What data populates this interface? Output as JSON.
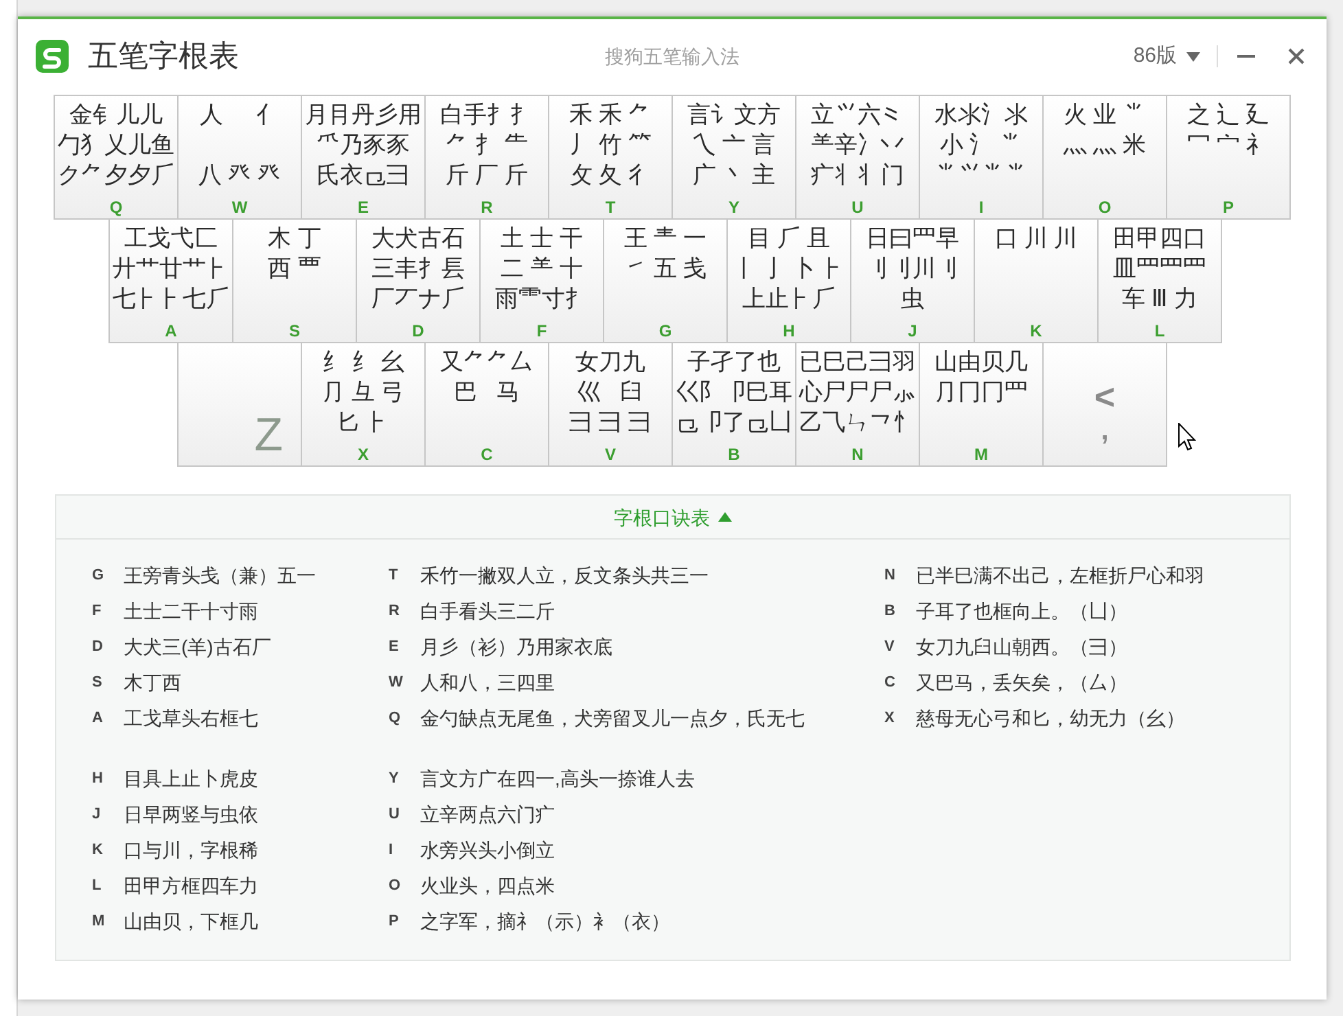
{
  "window": {
    "title": "五笔字根表",
    "subtitle": "搜狗五笔输入法",
    "version": "86版"
  },
  "keyboard": {
    "rows": [
      [
        {
          "kind": "radicals",
          "letter": "Q",
          "lines": [
            "金钅儿儿",
            "勹犭乂儿鱼",
            "ク⺈夕夕⺁"
          ]
        },
        {
          "kind": "radicals-spread",
          "letter": "W",
          "lines": [
            "人     亻",
            "八 癶 癶"
          ]
        },
        {
          "kind": "radicals",
          "letter": "E",
          "lines": [
            "月⺝丹彡用",
            "⺥乃豕豕",
            "氏衣⺋⺕"
          ]
        },
        {
          "kind": "radicals",
          "letter": "R",
          "lines": [
            "白手⺘扌",
            "⺈ ⺘ ⺧",
            "斤 厂 斤"
          ]
        },
        {
          "kind": "radicals",
          "letter": "T",
          "lines": [
            "禾 ⽲ ⺈",
            "丿 竹 ⺮",
            "攵 夂 彳"
          ]
        },
        {
          "kind": "radicals",
          "letter": "Y",
          "lines": [
            "言讠文方",
            "乀 亠 言",
            "广 丶 主"
          ]
        },
        {
          "kind": "radicals",
          "letter": "U",
          "lines": [
            "立⺍六⺀",
            "⺷辛冫丷",
            "疒丬丬门"
          ]
        },
        {
          "kind": "radicals",
          "letter": "I",
          "lines": [
            "水氺⺡⺢",
            "小 氵 ⺌",
            "⺌⺍⺌⺌"
          ]
        },
        {
          "kind": "radicals",
          "letter": "O",
          "lines": [
            "火 业 ⺌",
            "灬 ⺣ 米"
          ]
        },
        {
          "kind": "radicals",
          "letter": "P",
          "lines": [
            "之 辶 廴",
            "冖 宀 礻"
          ]
        }
      ],
      [
        {
          "kind": "radicals",
          "letter": "A",
          "lines": [
            "工戈弋匚",
            "廾艹廿⺾⺊",
            "七⺊⺊七⺁"
          ]
        },
        {
          "kind": "radicals",
          "letter": "S",
          "lines": [
            "木 丁",
            "西 覀"
          ]
        },
        {
          "kind": "radicals",
          "letter": "D",
          "lines": [
            "大犬古石",
            "三丰⺘镸",
            "厂丆ナ⺁"
          ]
        },
        {
          "kind": "radicals",
          "letter": "F",
          "lines": [
            "土 士 干",
            "二 ⺷ 十",
            "雨⻗寸⺘"
          ]
        },
        {
          "kind": "radicals",
          "letter": "G",
          "lines": [
            "王 龶 一",
            "㇀ 五 戋"
          ]
        },
        {
          "kind": "radicals",
          "letter": "H",
          "lines": [
            "目 ⺁ 且",
            "丨 亅 卜 ⺊",
            "上止⺊⺁"
          ]
        },
        {
          "kind": "radicals",
          "letter": "J",
          "lines": [
            "日曰⺫早",
            "刂刂川刂",
            "虫"
          ]
        },
        {
          "kind": "radicals",
          "letter": "K",
          "lines": [
            "口 川 川"
          ]
        },
        {
          "kind": "radicals",
          "letter": "L",
          "lines": [
            "田甲四口",
            "皿罒⺫⺲",
            "车 Ⅲ 力"
          ]
        }
      ],
      [
        {
          "kind": "letter",
          "letter": "Z"
        },
        {
          "kind": "radicals",
          "letter": "X",
          "lines": [
            "纟 纟 幺",
            "⺆ 彑 弓",
            "匕 ⺊"
          ]
        },
        {
          "kind": "radicals",
          "letter": "C",
          "lines": [
            "又⺈⺈厶",
            "巴   马"
          ]
        },
        {
          "kind": "radicals",
          "letter": "V",
          "lines": [
            "女刀九",
            "巛   臼",
            "彐 ⺕ ⺕"
          ]
        },
        {
          "kind": "radicals",
          "letter": "B",
          "lines": [
            "子孑了也",
            "巜阝卩巳耳",
            "⺋卩了⺋凵"
          ]
        },
        {
          "kind": "radicals",
          "letter": "N",
          "lines": [
            "已巳己⺕羽",
            "心尸尸尸⺗",
            "乙⺄ㄣ⺂⺖"
          ]
        },
        {
          "kind": "radicals",
          "letter": "M",
          "lines": [
            "山由贝几",
            "⺆冂冂⺫"
          ]
        },
        {
          "kind": "symbols",
          "lines": [
            "<",
            ","
          ]
        }
      ]
    ]
  },
  "mnemonics": {
    "title": "字根口诀表",
    "expanded": true,
    "columns": [
      [
        [
          {
            "key": "G",
            "text": "王旁青头戋（兼）五一"
          },
          {
            "key": "F",
            "text": "土士二干十寸雨"
          },
          {
            "key": "D",
            "text": "大犬三(羊)古石厂"
          },
          {
            "key": "S",
            "text": "木丁西"
          },
          {
            "key": "A",
            "text": "工戈草头右框七"
          }
        ],
        [
          {
            "key": "H",
            "text": "目具上止卜虎皮"
          },
          {
            "key": "J",
            "text": "日早两竖与虫依"
          },
          {
            "key": "K",
            "text": "口与川，字根稀"
          },
          {
            "key": "L",
            "text": "田甲方框四车力"
          },
          {
            "key": "M",
            "text": "山由贝，下框几"
          }
        ]
      ],
      [
        [
          {
            "key": "T",
            "text": "禾竹一撇双人立，反文条头共三一"
          },
          {
            "key": "R",
            "text": "白手看头三二斤"
          },
          {
            "key": "E",
            "text": "月彡（衫）乃用家衣底"
          },
          {
            "key": "W",
            "text": "人和八，三四里"
          },
          {
            "key": "Q",
            "text": "金勺缺点无尾鱼，犬旁留叉儿一点夕，氏无七"
          }
        ],
        [
          {
            "key": "Y",
            "text": "言文方广在四一,高头一捺谁人去"
          },
          {
            "key": "U",
            "text": "立辛两点六门疒"
          },
          {
            "key": "I",
            "text": "水旁兴头小倒立"
          },
          {
            "key": "O",
            "text": "火业头，四点米"
          },
          {
            "key": "P",
            "text": "之字军，摘礻（示）衤（衣）"
          }
        ]
      ],
      [
        [
          {
            "key": "N",
            "text": "已半巳满不出己，左框折尸心和羽"
          },
          {
            "key": "B",
            "text": "子耳了也框向上。（凵）"
          },
          {
            "key": "V",
            "text": "女刀九臼山朝西。（彐）"
          },
          {
            "key": "C",
            "text": "又巴马，丢矢矣，（厶）"
          },
          {
            "key": "X",
            "text": "慈母无心弓和匕，幼无力（幺）"
          }
        ]
      ]
    ]
  }
}
